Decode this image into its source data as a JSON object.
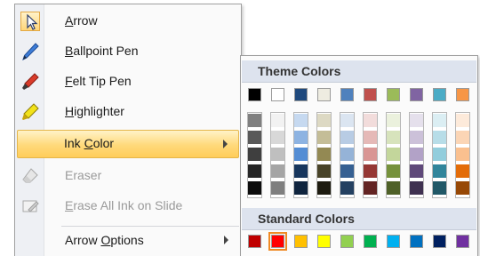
{
  "menu": {
    "items": [
      {
        "label": "Arrow",
        "mnemonic": "A",
        "rest": "rrow",
        "icon": "arrow-pointer-icon"
      },
      {
        "label": "Ballpoint Pen",
        "mnemonic": "B",
        "rest": "allpoint Pen",
        "icon": "ballpoint-pen-icon"
      },
      {
        "label": "Felt Tip Pen",
        "mnemonic": "F",
        "rest": "elt Tip Pen",
        "icon": "felt-tip-pen-icon"
      },
      {
        "label": "Highlighter",
        "mnemonic": "H",
        "rest": "ighlighter",
        "icon": "highlighter-icon"
      },
      {
        "label": "Ink Color",
        "pre": "Ink ",
        "mnemonic": "C",
        "rest": "olor"
      },
      {
        "label": "Eraser",
        "icon": "eraser-icon"
      },
      {
        "label": "Erase All Ink on Slide",
        "mnemonic": "E",
        "rest": "rase All Ink on Slide",
        "icon": "erase-all-ink-icon"
      },
      {
        "label": "Arrow Options",
        "pre": "Arrow ",
        "mnemonic": "O",
        "rest": "ptions"
      }
    ]
  },
  "palette": {
    "theme_title": "Theme Colors",
    "standard_title": "Standard Colors",
    "theme_top": [
      "#000000",
      "#ffffff",
      "#1f497d",
      "#eeece1",
      "#4f81bd",
      "#c0504d",
      "#9bbb59",
      "#8064a2",
      "#4bacc6",
      "#f79646"
    ],
    "theme_shades": [
      [
        "#7f7f7f",
        "#595959",
        "#3f3f3f",
        "#262626",
        "#0c0c0c"
      ],
      [
        "#f2f2f2",
        "#d8d8d8",
        "#bfbfbf",
        "#a5a5a5",
        "#7f7f7f"
      ],
      [
        "#c6d9f0",
        "#8db3e2",
        "#548dd4",
        "#17365d",
        "#0f243e"
      ],
      [
        "#ddd9c3",
        "#c4bd97",
        "#938953",
        "#494429",
        "#1d1b10"
      ],
      [
        "#dbe5f1",
        "#b8cce4",
        "#95b3d7",
        "#366092",
        "#244061"
      ],
      [
        "#f2dcdb",
        "#e5b9b7",
        "#d99694",
        "#953734",
        "#632423"
      ],
      [
        "#ebf1dd",
        "#d7e3bc",
        "#c3d69b",
        "#76923c",
        "#4f6128"
      ],
      [
        "#e5e0ec",
        "#ccc1d9",
        "#b2a2c7",
        "#5f497a",
        "#3f3151"
      ],
      [
        "#dbeef3",
        "#b7dde8",
        "#92cddc",
        "#31859b",
        "#205867"
      ],
      [
        "#fdeada",
        "#fbd5b5",
        "#fac08f",
        "#e36c09",
        "#974806"
      ]
    ],
    "standard": [
      "#c00000",
      "#ff0000",
      "#ffc000",
      "#ffff00",
      "#92d050",
      "#00b050",
      "#00b0f0",
      "#0070c0",
      "#002060",
      "#7030a0"
    ],
    "selected_standard_index": 1
  }
}
